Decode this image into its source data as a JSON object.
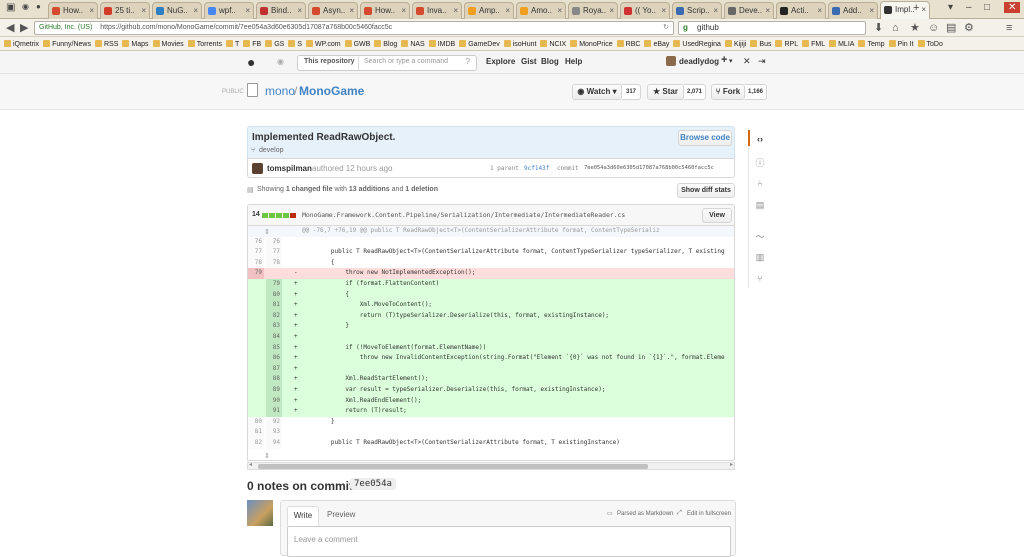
{
  "tabs": [
    {
      "label": "How..",
      "fav": "#d44a2f"
    },
    {
      "label": "25 ti..",
      "fav": "#d43c2a"
    },
    {
      "label": "NuG..",
      "fav": "#2d7fc1"
    },
    {
      "label": "wpf..",
      "fav": "#4586f0"
    },
    {
      "label": "Bind..",
      "fav": "#c03030"
    },
    {
      "label": "Asyn..",
      "fav": "#d44a2f"
    },
    {
      "label": "How..",
      "fav": "#d44a2f"
    },
    {
      "label": "Inva..",
      "fav": "#d44a2f"
    },
    {
      "label": "Amp..",
      "fav": "#f0a020"
    },
    {
      "label": "Amo..",
      "fav": "#f0a020"
    },
    {
      "label": "Roya..",
      "fav": "#888888"
    },
    {
      "label": "(( Yo..",
      "fav": "#d03030"
    },
    {
      "label": "Scrip..",
      "fav": "#3a6ab0"
    },
    {
      "label": "Deve..",
      "fav": "#666666"
    },
    {
      "label": "Acti..",
      "fav": "#222222"
    },
    {
      "label": "Add..",
      "fav": "#3a6ab0"
    },
    {
      "label": "Impl..",
      "fav": "#333333"
    }
  ],
  "browser": {
    "site_identity": "GitHub, Inc. (US)",
    "url": "https://github.com/mono/MonoGame/commit/7ee054a3d60e6305d17087a768b00c5460facc5c",
    "search_value": "github",
    "bookmarks": [
      "iQmetrix",
      "Funny/News",
      "RSS",
      "Maps",
      "Movies",
      "Torrents",
      "T",
      "FB",
      "GS",
      "S",
      "WP.com",
      "GWB",
      "Blog",
      "NAS",
      "IMDB",
      "GameDev",
      "isoHunt",
      "NCIX",
      "MonoPrice",
      "RBC",
      "eBay",
      "UsedRegina",
      "Kijiji",
      "Bus",
      "RPL",
      "FML",
      "MLIA",
      "Temp",
      "Pin It",
      "ToDo"
    ]
  },
  "github": {
    "scope_label": "This repository",
    "search_placeholder": "Search or type a command",
    "nav": [
      "Explore",
      "Gist",
      "Blog",
      "Help"
    ],
    "username": "deadlydog",
    "new_label": "+",
    "repo_visibility": "PUBLIC",
    "repo_owner": "mono",
    "repo_sep": "/",
    "repo_name": "MonoGame",
    "watch_label": "Watch",
    "watch_count": "317",
    "star_label": "Star",
    "star_count": "2,071",
    "fork_label": "Fork",
    "fork_count": "1,166"
  },
  "commit": {
    "title": "Implemented ReadRawObject.",
    "browse_label": "Browse code",
    "branch": "develop",
    "author": "tomspilman",
    "authored": "authored 12 hours ago",
    "parent_label": "1 parent",
    "parent_sha": "9cf143f",
    "commit_label": "commit",
    "commit_sha": "7ee054a3d60e6305d17087a768b00c5460facc5c",
    "summary_prefix": "Showing",
    "summary_files": "1 changed file",
    "summary_with": "with",
    "summary_add": "13 additions",
    "summary_and": "and",
    "summary_del": "1 deletion",
    "show_diff_stats": "Show diff stats"
  },
  "file": {
    "changes": "14",
    "path": "MonoGame.Framework.Content.Pipeline/Serialization/Intermediate/IntermediateReader.cs",
    "view_label": "View"
  },
  "diff_lines": [
    {
      "t": "hunk",
      "o": "",
      "n": "",
      "s": "",
      "c": "@@ -76,7 +76,19 @@ public T ReadRawObject<T>(ContentSerializerAttribute format, ContentTypeSerializ"
    },
    {
      "t": "ctx",
      "o": "76",
      "n": "76",
      "s": "",
      "c": ""
    },
    {
      "t": "ctx",
      "o": "77",
      "n": "77",
      "s": "",
      "c": "        public T ReadRawObject<T>(ContentSerializerAttribute format, ContentTypeSerializer typeSerializer, T existing"
    },
    {
      "t": "ctx",
      "o": "78",
      "n": "78",
      "s": "",
      "c": "        {"
    },
    {
      "t": "del",
      "o": "79",
      "n": "",
      "s": "-",
      "c": "            throw new NotImplementedException();"
    },
    {
      "t": "add",
      "o": "",
      "n": "79",
      "s": "+",
      "c": "            if (format.FlattenContent)"
    },
    {
      "t": "add",
      "o": "",
      "n": "80",
      "s": "+",
      "c": "            {"
    },
    {
      "t": "add",
      "o": "",
      "n": "81",
      "s": "+",
      "c": "                Xml.MoveToContent();"
    },
    {
      "t": "add",
      "o": "",
      "n": "82",
      "s": "+",
      "c": "                return (T)typeSerializer.Deserialize(this, format, existingInstance);"
    },
    {
      "t": "add",
      "o": "",
      "n": "83",
      "s": "+",
      "c": "            }"
    },
    {
      "t": "add",
      "o": "",
      "n": "84",
      "s": "+",
      "c": ""
    },
    {
      "t": "add",
      "o": "",
      "n": "85",
      "s": "+",
      "c": "            if (!MoveToElement(format.ElementName))"
    },
    {
      "t": "add",
      "o": "",
      "n": "86",
      "s": "+",
      "c": "                throw new InvalidContentException(string.Format(\"Element `{0}` was not found in `{1}`.\", format.Eleme"
    },
    {
      "t": "add",
      "o": "",
      "n": "87",
      "s": "+",
      "c": ""
    },
    {
      "t": "add",
      "o": "",
      "n": "88",
      "s": "+",
      "c": "            Xml.ReadStartElement();"
    },
    {
      "t": "add",
      "o": "",
      "n": "89",
      "s": "+",
      "c": "            var result = typeSerializer.Deserialize(this, format, existingInstance);"
    },
    {
      "t": "add",
      "o": "",
      "n": "90",
      "s": "+",
      "c": "            Xml.ReadEndElement();"
    },
    {
      "t": "add",
      "o": "",
      "n": "91",
      "s": "+",
      "c": "            return (T)result;"
    },
    {
      "t": "ctx",
      "o": "80",
      "n": "92",
      "s": "",
      "c": "        }"
    },
    {
      "t": "ctx",
      "o": "81",
      "n": "93",
      "s": "",
      "c": ""
    },
    {
      "t": "ctx",
      "o": "82",
      "n": "94",
      "s": "",
      "c": "        public T ReadRawObject<T>(ContentSerializerAttribute format, T existingInstance)"
    }
  ],
  "notes": {
    "heading": "0 notes on commit",
    "sha": "7ee054a",
    "write_tab": "Write",
    "preview_tab": "Preview",
    "markdown_label": "Parsed as Markdown",
    "fullscreen_label": "Edit in fullscreen",
    "comment_placeholder": "Leave a comment"
  }
}
